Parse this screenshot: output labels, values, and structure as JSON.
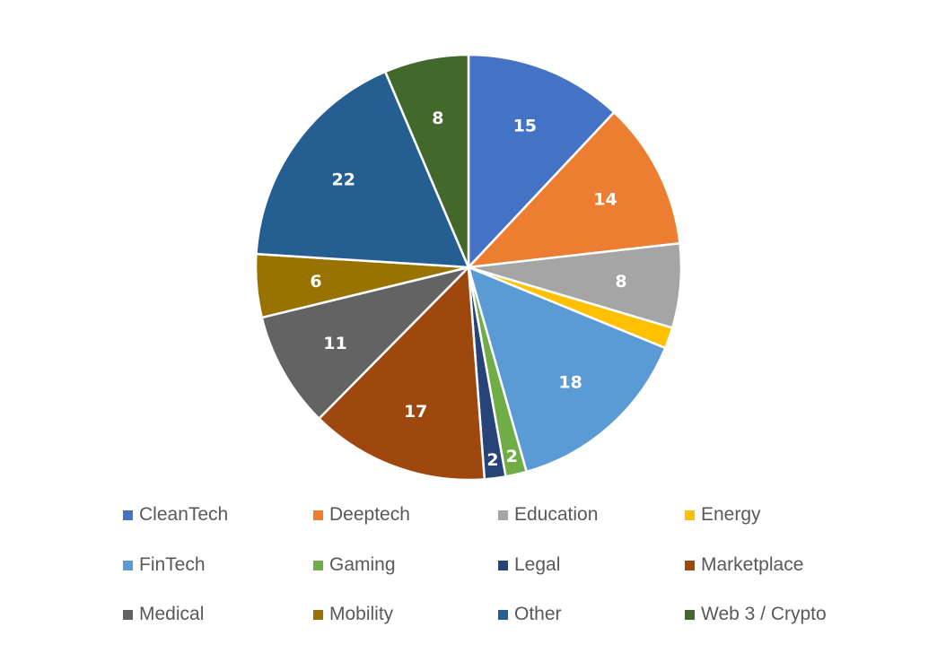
{
  "chart_data": {
    "type": "pie",
    "title": "",
    "start_angle": "top, clockwise",
    "legend_position": "bottom",
    "slices": [
      {
        "label": "CleanTech",
        "value": 15,
        "color": "#4472C4",
        "show_label": true
      },
      {
        "label": "Deeptech",
        "value": 14,
        "color": "#ED7D31",
        "show_label": true
      },
      {
        "label": "Education",
        "value": 8,
        "color": "#A5A5A5",
        "show_label": true
      },
      {
        "label": "Energy",
        "value": 2,
        "color": "#FFC000",
        "show_label": false
      },
      {
        "label": "FinTech",
        "value": 18,
        "color": "#5B9BD5",
        "show_label": true
      },
      {
        "label": "Gaming",
        "value": 2,
        "color": "#70AD47",
        "show_label": true
      },
      {
        "label": "Legal",
        "value": 2,
        "color": "#264478",
        "show_label": true
      },
      {
        "label": "Marketplace",
        "value": 17,
        "color": "#9E480E",
        "show_label": true
      },
      {
        "label": "Medical",
        "value": 11,
        "color": "#636363",
        "show_label": true
      },
      {
        "label": "Mobility",
        "value": 6,
        "color": "#997300",
        "show_label": true
      },
      {
        "label": "Other",
        "value": 22,
        "color": "#255E91",
        "show_label": true
      },
      {
        "label": "Web 3 / Crypto",
        "value": 8,
        "color": "#43682B",
        "show_label": true
      }
    ]
  }
}
